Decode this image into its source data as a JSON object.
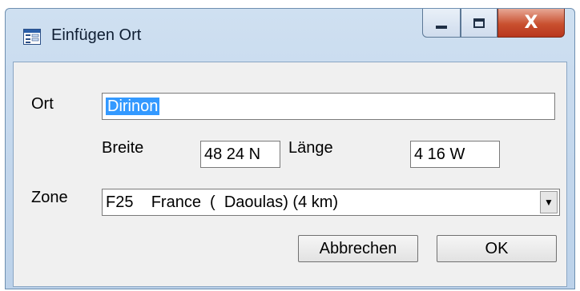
{
  "window": {
    "title": "Einfügen Ort",
    "close_glyph": "X"
  },
  "form": {
    "ort_label": "Ort",
    "ort_value": "Dirinon",
    "breite_label": "Breite",
    "breite_value": "48 24 N",
    "laenge_label": "Länge",
    "laenge_value": "4 16 W",
    "zone_label": "Zone",
    "zone_value": "F25    France  (  Daoulas) (4 km)"
  },
  "buttons": {
    "cancel_label": "Abbrechen",
    "ok_label": "OK"
  },
  "icons": {
    "app": "dialog-form-icon",
    "minimize": "minimize-icon",
    "maximize": "maximize-icon",
    "close": "close-icon",
    "dropdown": "chevron-down-icon"
  }
}
